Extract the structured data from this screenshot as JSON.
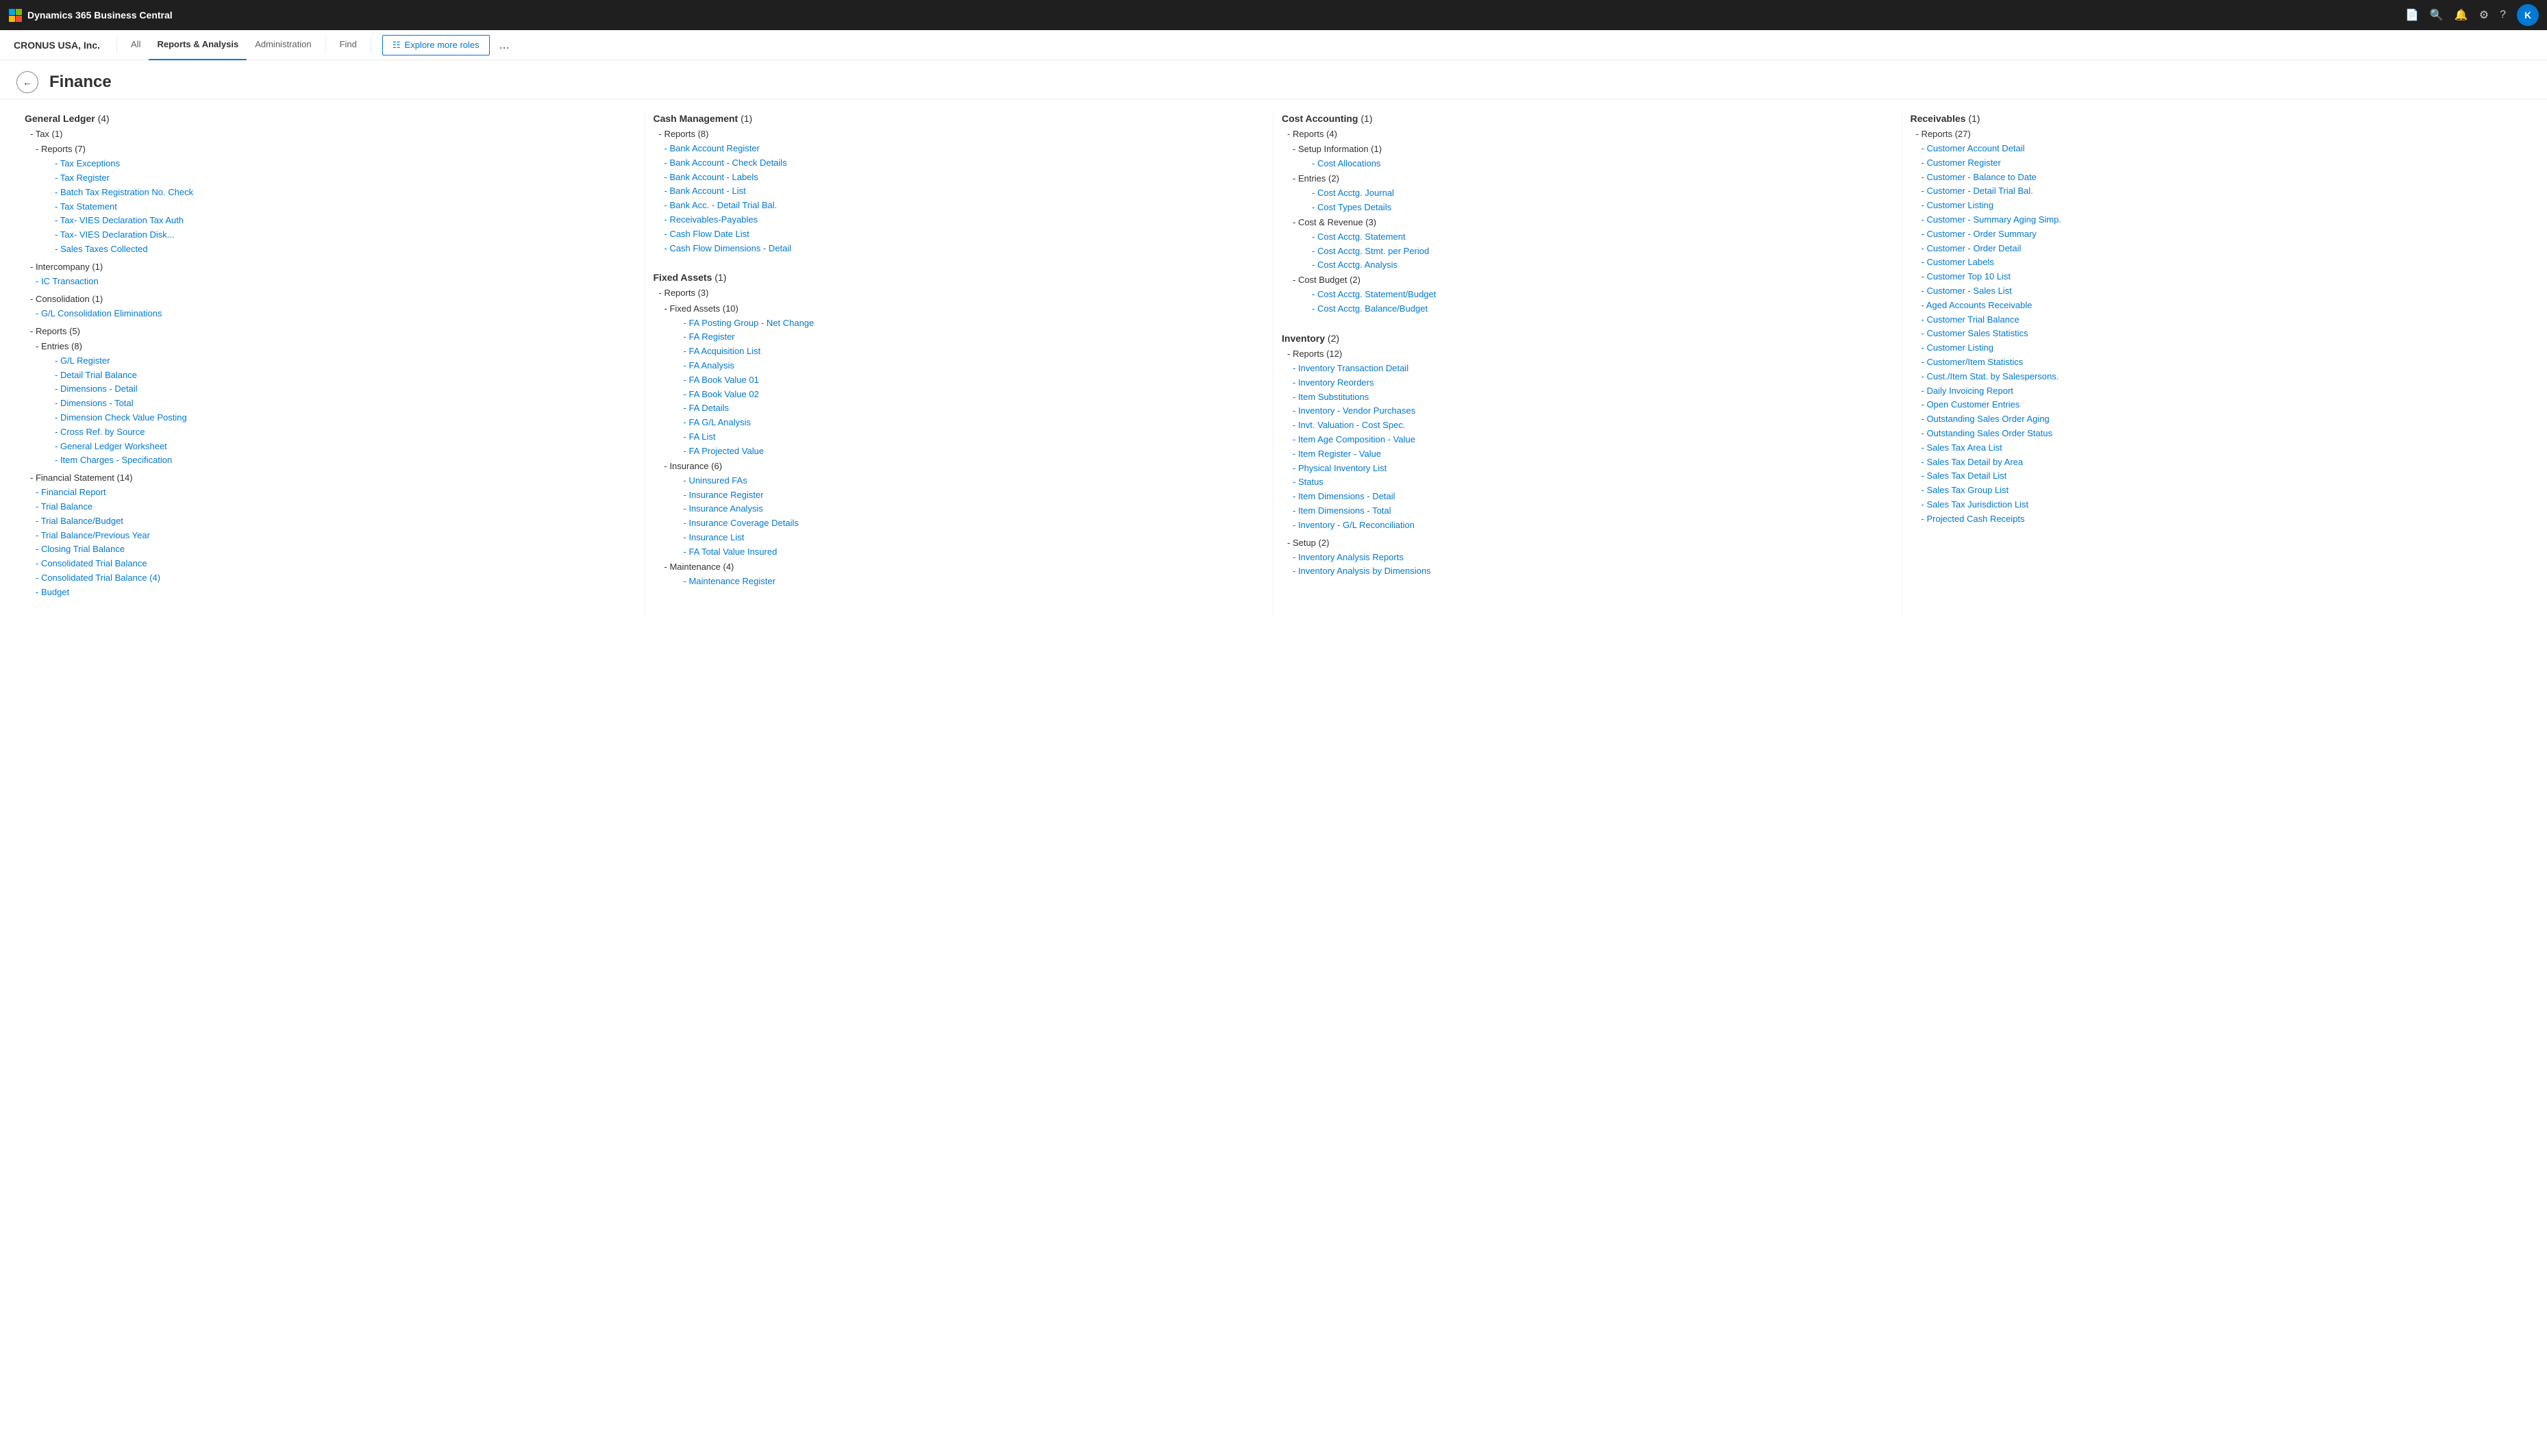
{
  "topbar": {
    "app_name": "Dynamics 365 Business Central",
    "avatar_letter": "K"
  },
  "subnav": {
    "company": "CRONUS USA, Inc.",
    "items": [
      {
        "label": "All",
        "active": false
      },
      {
        "label": "Reports & Analysis",
        "active": true
      },
      {
        "label": "Administration",
        "active": false
      },
      {
        "label": "Find",
        "active": false
      }
    ],
    "explore_label": "Explore more roles",
    "more": "..."
  },
  "page": {
    "title": "Finance",
    "back_label": "←"
  },
  "columns": [
    {
      "name": "General Ledger",
      "count": "(4)",
      "sections": [
        {
          "label": "- Tax (1)",
          "indent": 1,
          "children": [
            {
              "label": "- Reports (7)",
              "indent": 2,
              "type": "header",
              "children": [
                {
                  "label": "- Tax Exceptions",
                  "indent": 3,
                  "type": "link"
                },
                {
                  "label": "- Tax Register",
                  "indent": 3,
                  "type": "link"
                },
                {
                  "label": "- Batch Tax Registration No. Check",
                  "indent": 3,
                  "type": "link"
                },
                {
                  "label": "- Tax Statement",
                  "indent": 3,
                  "type": "link"
                },
                {
                  "label": "- Tax- VIES Declaration Tax Auth",
                  "indent": 3,
                  "type": "link"
                },
                {
                  "label": "- Tax- VIES Declaration Disk...",
                  "indent": 3,
                  "type": "link"
                },
                {
                  "label": "- Sales Taxes Collected",
                  "indent": 3,
                  "type": "link"
                }
              ]
            }
          ]
        },
        {
          "label": "- Intercompany (1)",
          "indent": 1,
          "children": [
            {
              "label": "- IC Transaction",
              "indent": 2,
              "type": "link"
            }
          ]
        },
        {
          "label": "- Consolidation (1)",
          "indent": 1,
          "children": [
            {
              "label": "- G/L Consolidation Eliminations",
              "indent": 2,
              "type": "link"
            }
          ]
        },
        {
          "label": "- Reports (5)",
          "indent": 1,
          "children": [
            {
              "label": "- Entries (8)",
              "indent": 2,
              "type": "header",
              "children": [
                {
                  "label": "- G/L Register",
                  "indent": 3,
                  "type": "link"
                },
                {
                  "label": "- Detail Trial Balance",
                  "indent": 3,
                  "type": "link"
                },
                {
                  "label": "- Dimensions - Detail",
                  "indent": 3,
                  "type": "link"
                },
                {
                  "label": "- Dimensions - Total",
                  "indent": 3,
                  "type": "link"
                },
                {
                  "label": "- Dimension Check Value Posting",
                  "indent": 3,
                  "type": "link"
                },
                {
                  "label": "- Cross Ref. by Source",
                  "indent": 3,
                  "type": "link"
                },
                {
                  "label": "- General Ledger Worksheet",
                  "indent": 3,
                  "type": "link"
                },
                {
                  "label": "- Item Charges - Specification",
                  "indent": 3,
                  "type": "link"
                }
              ]
            }
          ]
        },
        {
          "label": "- Financial Statement (14)",
          "indent": 1,
          "children": [
            {
              "label": "- Financial Report",
              "indent": 2,
              "type": "link"
            },
            {
              "label": "- Trial Balance",
              "indent": 2,
              "type": "link"
            },
            {
              "label": "- Trial Balance/Budget",
              "indent": 2,
              "type": "link"
            },
            {
              "label": "- Trial Balance/Previous Year",
              "indent": 2,
              "type": "link"
            },
            {
              "label": "- Closing Trial Balance",
              "indent": 2,
              "type": "link"
            },
            {
              "label": "- Consolidated Trial Balance",
              "indent": 2,
              "type": "link"
            },
            {
              "label": "- Consolidated Trial Balance (4)",
              "indent": 2,
              "type": "link"
            },
            {
              "label": "- Budget",
              "indent": 2,
              "type": "link"
            }
          ]
        }
      ]
    },
    {
      "name": "Cash Management",
      "count": "(1)",
      "sections": [
        {
          "label": "- Reports (8)",
          "indent": 1,
          "children": [
            {
              "label": "- Bank Account Register",
              "indent": 2,
              "type": "link"
            },
            {
              "label": "- Bank Account - Check Details",
              "indent": 2,
              "type": "link"
            },
            {
              "label": "- Bank Account - Labels",
              "indent": 2,
              "type": "link"
            },
            {
              "label": "- Bank Account - List",
              "indent": 2,
              "type": "link"
            },
            {
              "label": "- Bank Acc. - Detail Trial Bal.",
              "indent": 2,
              "type": "link"
            },
            {
              "label": "- Receivables-Payables",
              "indent": 2,
              "type": "link"
            },
            {
              "label": "- Cash Flow Date List",
              "indent": 2,
              "type": "link"
            },
            {
              "label": "- Cash Flow Dimensions - Detail",
              "indent": 2,
              "type": "link"
            }
          ]
        }
      ]
    },
    {
      "name": "Fixed Assets",
      "count": "(1)",
      "sections": [
        {
          "label": "- Reports (3)",
          "indent": 1,
          "children": [
            {
              "label": "- Fixed Assets (10)",
              "indent": 2,
              "type": "header",
              "children": [
                {
                  "label": "- FA Posting Group - Net Change",
                  "indent": 3,
                  "type": "link"
                },
                {
                  "label": "- FA Register",
                  "indent": 3,
                  "type": "link"
                },
                {
                  "label": "- FA Acquisition List",
                  "indent": 3,
                  "type": "link"
                },
                {
                  "label": "- FA Analysis",
                  "indent": 3,
                  "type": "link"
                },
                {
                  "label": "- FA Book Value 01",
                  "indent": 3,
                  "type": "link"
                },
                {
                  "label": "- FA Book Value 02",
                  "indent": 3,
                  "type": "link"
                },
                {
                  "label": "- FA Details",
                  "indent": 3,
                  "type": "link"
                },
                {
                  "label": "- FA G/L Analysis",
                  "indent": 3,
                  "type": "link"
                },
                {
                  "label": "- FA List",
                  "indent": 3,
                  "type": "link"
                },
                {
                  "label": "- FA Projected Value",
                  "indent": 3,
                  "type": "link"
                }
              ]
            },
            {
              "label": "- Insurance (6)",
              "indent": 2,
              "type": "header",
              "children": [
                {
                  "label": "- Uninsured FAs",
                  "indent": 3,
                  "type": "link"
                },
                {
                  "label": "- Insurance Register",
                  "indent": 3,
                  "type": "link"
                },
                {
                  "label": "- Insurance Analysis",
                  "indent": 3,
                  "type": "link"
                },
                {
                  "label": "- Insurance Coverage Details",
                  "indent": 3,
                  "type": "link"
                },
                {
                  "label": "- Insurance List",
                  "indent": 3,
                  "type": "link"
                },
                {
                  "label": "- FA Total Value Insured",
                  "indent": 3,
                  "type": "link"
                }
              ]
            },
            {
              "label": "- Maintenance (4)",
              "indent": 2,
              "type": "header",
              "children": [
                {
                  "label": "- Maintenance Register",
                  "indent": 3,
                  "type": "link"
                }
              ]
            }
          ]
        }
      ]
    },
    {
      "name": "Cost Accounting",
      "count": "(1)",
      "sections": [
        {
          "label": "- Reports (4)",
          "indent": 1,
          "children": [
            {
              "label": "- Setup Information (1)",
              "indent": 2,
              "type": "header",
              "children": [
                {
                  "label": "- Cost Allocations",
                  "indent": 3,
                  "type": "link"
                }
              ]
            },
            {
              "label": "- Entries (2)",
              "indent": 2,
              "type": "header",
              "children": [
                {
                  "label": "- Cost Acctg. Journal",
                  "indent": 3,
                  "type": "link"
                },
                {
                  "label": "- Cost Types Details",
                  "indent": 3,
                  "type": "link"
                }
              ]
            },
            {
              "label": "- Cost & Revenue (3)",
              "indent": 2,
              "type": "header",
              "children": [
                {
                  "label": "- Cost Acctg. Statement",
                  "indent": 3,
                  "type": "link"
                },
                {
                  "label": "- Cost Acctg. Stmt. per Period",
                  "indent": 3,
                  "type": "link"
                },
                {
                  "label": "- Cost Acctg. Analysis",
                  "indent": 3,
                  "type": "link"
                }
              ]
            },
            {
              "label": "- Cost Budget (2)",
              "indent": 2,
              "type": "header",
              "children": [
                {
                  "label": "- Cost Acctg. Statement/Budget",
                  "indent": 3,
                  "type": "link"
                },
                {
                  "label": "- Cost Acctg. Balance/Budget",
                  "indent": 3,
                  "type": "link"
                }
              ]
            }
          ]
        }
      ]
    },
    {
      "name": "Inventory",
      "count": "(2)",
      "sections": [
        {
          "label": "- Reports (12)",
          "indent": 1,
          "children": [
            {
              "label": "- Inventory Transaction Detail",
              "indent": 2,
              "type": "link"
            },
            {
              "label": "- Inventory Reorders",
              "indent": 2,
              "type": "link"
            },
            {
              "label": "- Item Substitutions",
              "indent": 2,
              "type": "link"
            },
            {
              "label": "- Inventory - Vendor Purchases",
              "indent": 2,
              "type": "link"
            },
            {
              "label": "- Invt. Valuation - Cost Spec.",
              "indent": 2,
              "type": "link"
            },
            {
              "label": "- Item Age Composition - Value",
              "indent": 2,
              "type": "link"
            },
            {
              "label": "- Item Register - Value",
              "indent": 2,
              "type": "link"
            },
            {
              "label": "- Physical Inventory List",
              "indent": 2,
              "type": "link"
            },
            {
              "label": "- Status",
              "indent": 2,
              "type": "link"
            },
            {
              "label": "- Item Dimensions - Detail",
              "indent": 2,
              "type": "link"
            },
            {
              "label": "- Item Dimensions - Total",
              "indent": 2,
              "type": "link"
            },
            {
              "label": "- Inventory - G/L Reconciliation",
              "indent": 2,
              "type": "link"
            }
          ]
        },
        {
          "label": "- Setup (2)",
          "indent": 1,
          "children": [
            {
              "label": "- Inventory Analysis Reports",
              "indent": 2,
              "type": "link"
            },
            {
              "label": "- Inventory Analysis by Dimensions",
              "indent": 2,
              "type": "link"
            }
          ]
        }
      ]
    },
    {
      "name": "Receivables",
      "count": "(1)",
      "sections": [
        {
          "label": "- Reports (27)",
          "indent": 1,
          "children": [
            {
              "label": "- Customer Account Detail",
              "indent": 2,
              "type": "link"
            },
            {
              "label": "- Customer Register",
              "indent": 2,
              "type": "link"
            },
            {
              "label": "- Customer - Balance to Date",
              "indent": 2,
              "type": "link"
            },
            {
              "label": "- Customer - Detail Trial Bal.",
              "indent": 2,
              "type": "link"
            },
            {
              "label": "- Customer Listing",
              "indent": 2,
              "type": "link"
            },
            {
              "label": "- Customer - Summary Aging Simp.",
              "indent": 2,
              "type": "link"
            },
            {
              "label": "- Customer - Order Summary",
              "indent": 2,
              "type": "link"
            },
            {
              "label": "- Customer - Order Detail",
              "indent": 2,
              "type": "link"
            },
            {
              "label": "- Customer Labels",
              "indent": 2,
              "type": "link"
            },
            {
              "label": "- Customer Top 10 List",
              "indent": 2,
              "type": "link"
            },
            {
              "label": "- Customer - Sales List",
              "indent": 2,
              "type": "link"
            },
            {
              "label": "- Aged Accounts Receivable",
              "indent": 2,
              "type": "link"
            },
            {
              "label": "- Customer Trial Balance",
              "indent": 2,
              "type": "link"
            },
            {
              "label": "- Customer Sales Statistics",
              "indent": 2,
              "type": "link"
            },
            {
              "label": "- Customer Listing",
              "indent": 2,
              "type": "link"
            },
            {
              "label": "- Customer/Item Statistics",
              "indent": 2,
              "type": "link"
            },
            {
              "label": "- Cust./Item Stat. by Salespersons.",
              "indent": 2,
              "type": "link"
            },
            {
              "label": "- Daily Invoicing Report",
              "indent": 2,
              "type": "link"
            },
            {
              "label": "- Open Customer Entries",
              "indent": 2,
              "type": "link"
            },
            {
              "label": "- Outstanding Sales Order Aging",
              "indent": 2,
              "type": "link"
            },
            {
              "label": "- Outstanding Sales Order Status",
              "indent": 2,
              "type": "link"
            },
            {
              "label": "- Sales Tax Area List",
              "indent": 2,
              "type": "link"
            },
            {
              "label": "- Sales Tax Detail by Area",
              "indent": 2,
              "type": "link"
            },
            {
              "label": "- Sales Tax Detail List",
              "indent": 2,
              "type": "link"
            },
            {
              "label": "- Sales Tax Group List",
              "indent": 2,
              "type": "link"
            },
            {
              "label": "- Sales Tax Jurisdiction List",
              "indent": 2,
              "type": "link"
            },
            {
              "label": "- Projected Cash Receipts",
              "indent": 2,
              "type": "link"
            }
          ]
        }
      ]
    }
  ]
}
